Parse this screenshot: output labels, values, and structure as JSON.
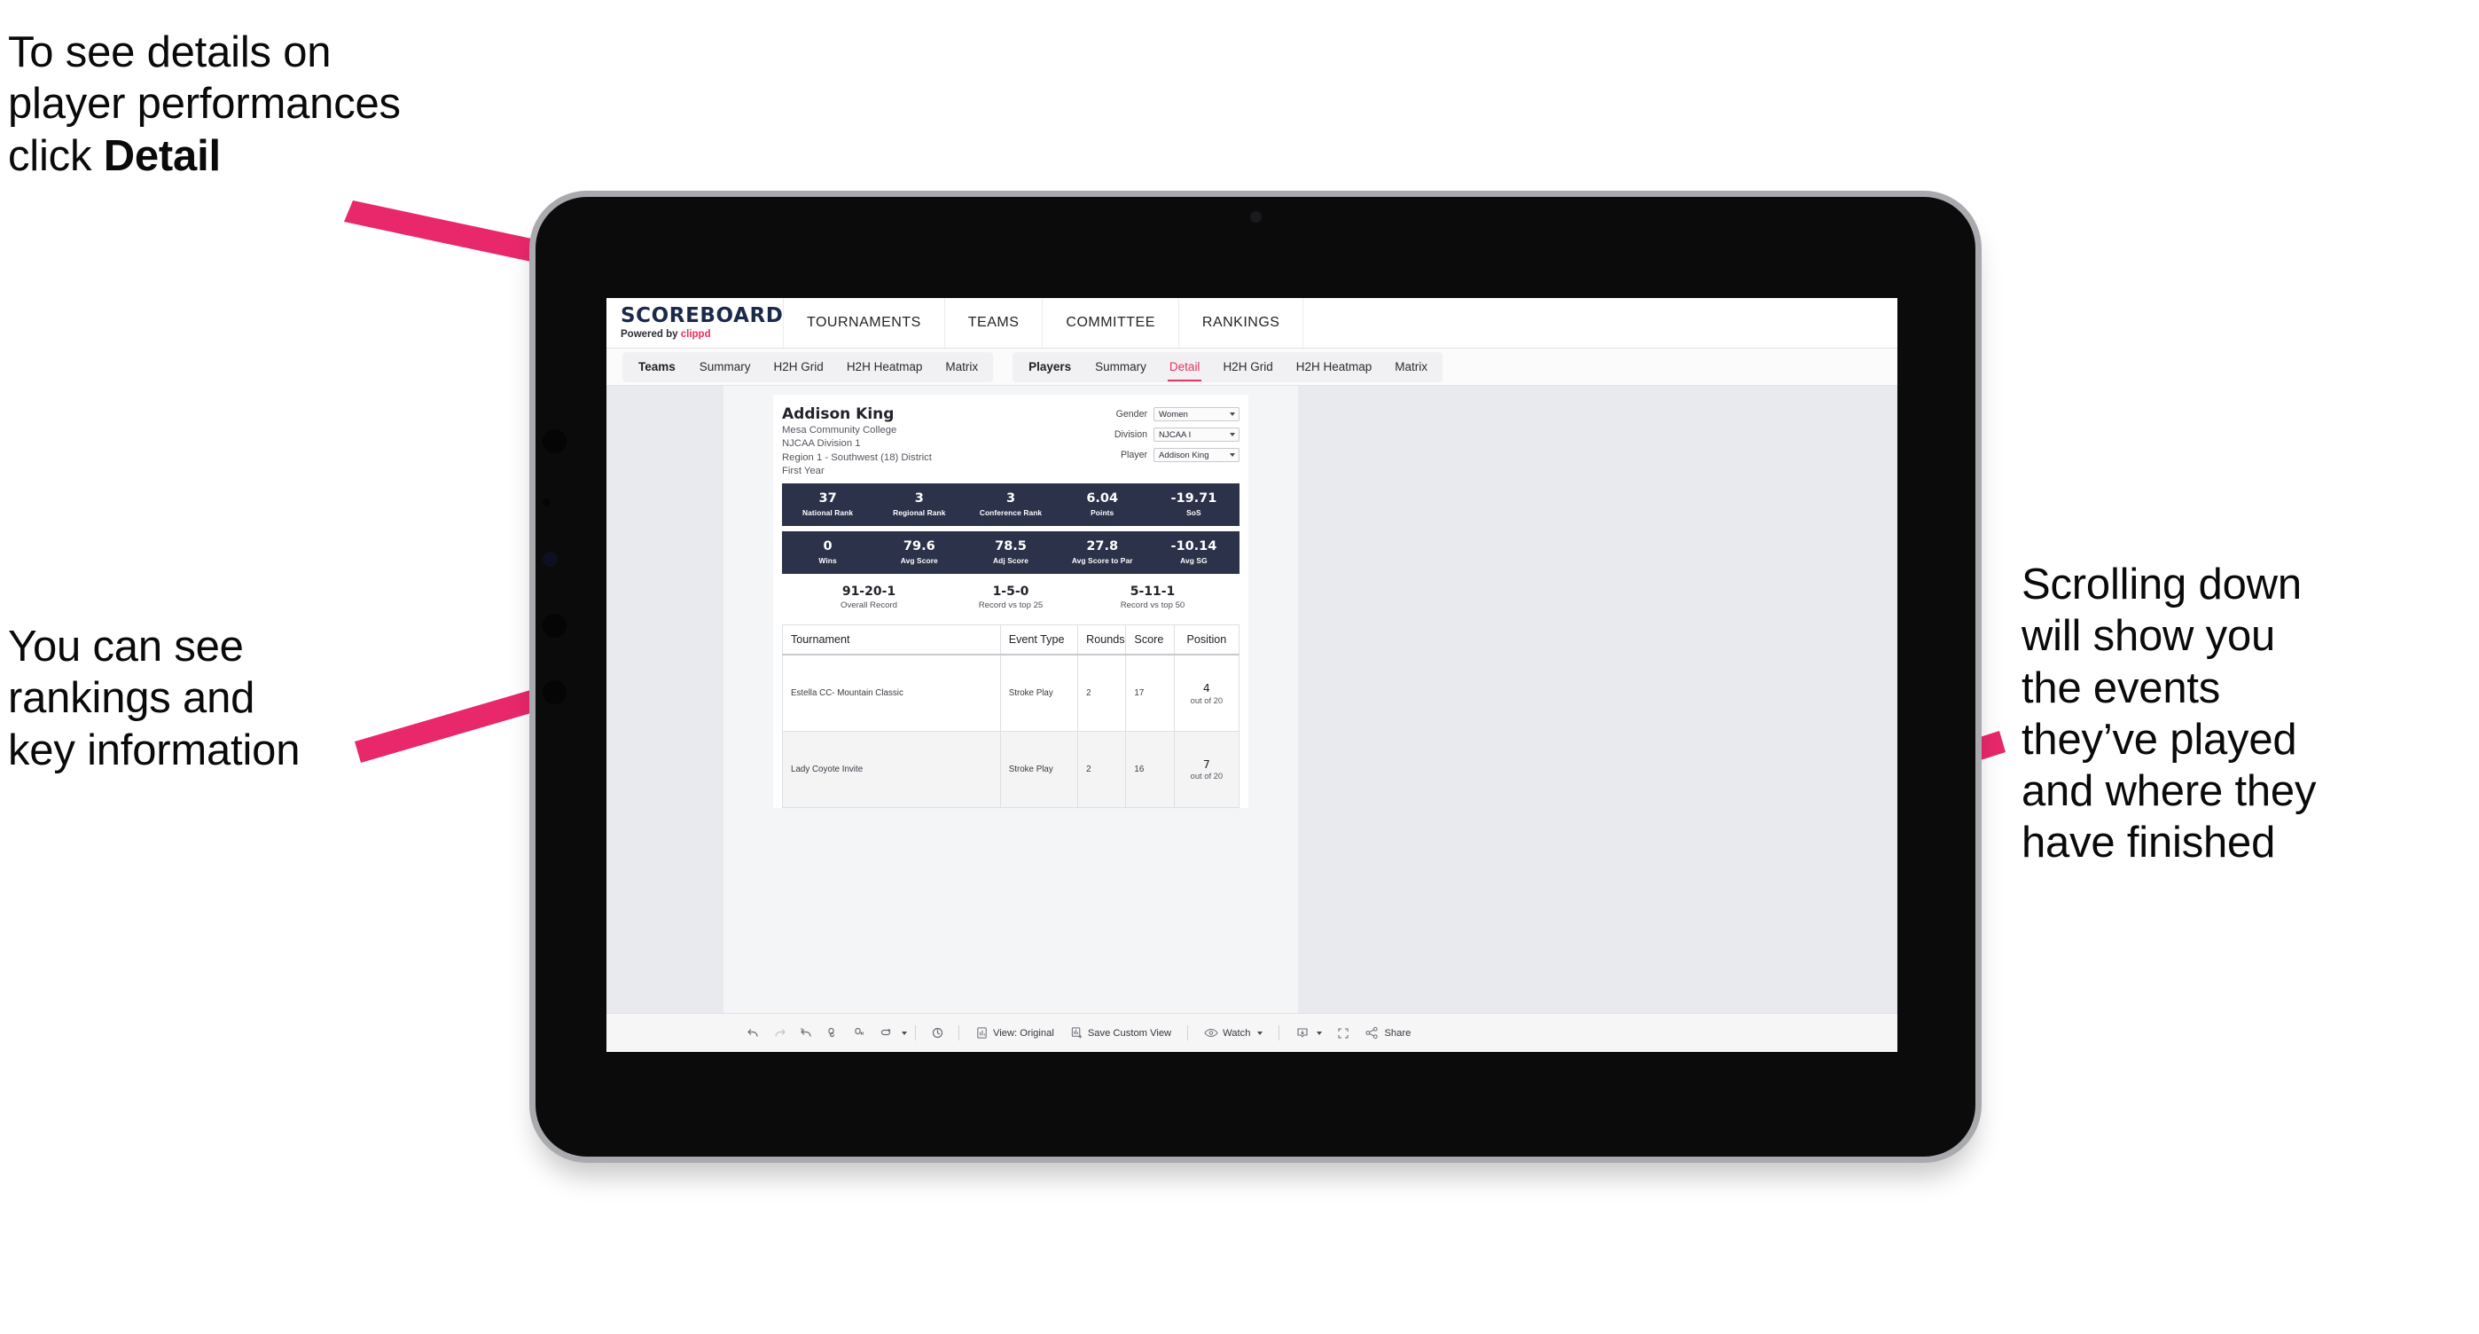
{
  "annotations": {
    "top_left": "To see details on\nplayer performances\nclick ",
    "top_left_bold": "Detail",
    "mid_left": "You can see\nrankings and\nkey information",
    "right": "Scrolling down\nwill show you\nthe events\nthey’ve played\nand where they\nhave finished",
    "arrow_color": "#e8286b"
  },
  "app": {
    "brand": {
      "name": "SCOREBOARD",
      "powered_prefix": "Powered by ",
      "powered_brand": "clippd"
    },
    "top_nav": [
      {
        "label": "TOURNAMENTS"
      },
      {
        "label": "TEAMS"
      },
      {
        "label": "COMMITTEE"
      },
      {
        "label": "RANKINGS"
      }
    ],
    "sub_nav": {
      "teams_group": {
        "title": "Teams",
        "items": [
          {
            "label": "Summary",
            "active": false
          },
          {
            "label": "H2H Grid",
            "active": false
          },
          {
            "label": "H2H Heatmap",
            "active": false
          },
          {
            "label": "Matrix",
            "active": false
          }
        ]
      },
      "players_group": {
        "title": "Players",
        "items": [
          {
            "label": "Summary",
            "active": false
          },
          {
            "label": "Detail",
            "active": true
          },
          {
            "label": "H2H Grid",
            "active": false
          },
          {
            "label": "H2H Heatmap",
            "active": false
          },
          {
            "label": "Matrix",
            "active": false
          }
        ]
      }
    }
  },
  "player": {
    "name": "Addison King",
    "school": "Mesa Community College",
    "division": "NJCAA Division 1",
    "region": "Region 1 - Southwest (18) District",
    "year": "First Year"
  },
  "filters": [
    {
      "label": "Gender",
      "value": "Women"
    },
    {
      "label": "Division",
      "value": "NJCAA I"
    },
    {
      "label": "Player",
      "value": "Addison King"
    }
  ],
  "stats_row_1": [
    {
      "value": "37",
      "label": "National Rank"
    },
    {
      "value": "3",
      "label": "Regional Rank"
    },
    {
      "value": "3",
      "label": "Conference Rank"
    },
    {
      "value": "6.04",
      "label": "Points"
    },
    {
      "value": "-19.71",
      "label": "SoS"
    }
  ],
  "stats_row_2": [
    {
      "value": "0",
      "label": "Wins"
    },
    {
      "value": "79.6",
      "label": "Avg Score"
    },
    {
      "value": "78.5",
      "label": "Adj Score"
    },
    {
      "value": "27.8",
      "label": "Avg Score to Par"
    },
    {
      "value": "-10.14",
      "label": "Avg SG"
    }
  ],
  "records": [
    {
      "value": "91-20-1",
      "label": "Overall Record"
    },
    {
      "value": "1-5-0",
      "label": "Record vs top 25"
    },
    {
      "value": "5-11-1",
      "label": "Record vs top 50"
    }
  ],
  "events_table": {
    "headers": [
      "Tournament",
      "Event Type",
      "Rounds",
      "Score",
      "Position"
    ],
    "rows": [
      {
        "tournament": "Estella CC- Mountain Classic",
        "event_type": "Stroke Play",
        "rounds": "2",
        "score": "17",
        "position": "4",
        "position_of": "out of 20"
      },
      {
        "tournament": "Lady Coyote Invite",
        "event_type": "Stroke Play",
        "rounds": "2",
        "score": "16",
        "position": "7",
        "position_of": "out of 20"
      }
    ]
  },
  "toolbar": {
    "view_label": "View: Original",
    "save_label": "Save Custom View",
    "watch_label": "Watch",
    "share_label": "Share"
  },
  "colors": {
    "stat_bar": "#2b3249",
    "accent": "#e63462",
    "brand_navy": "#1b2a4a",
    "clippd_pink": "#ef2a5b"
  }
}
